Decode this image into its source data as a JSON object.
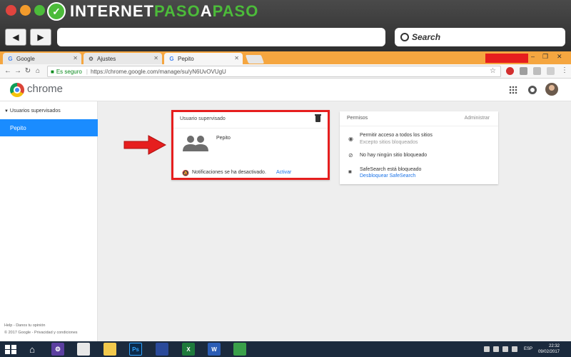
{
  "site_logo": {
    "prefix": "INTERNET",
    "accent": "PASO",
    "joiner": "A",
    "suffix": "PASO"
  },
  "outer_browser": {
    "search_placeholder": "Search"
  },
  "tabs": [
    {
      "label": "Google",
      "icon": "google-icon"
    },
    {
      "label": "Ajustes",
      "icon": "gear-icon"
    },
    {
      "label": "Pepito",
      "icon": "google-icon"
    }
  ],
  "omnibox": {
    "secure_label": "Es seguro",
    "url": "https://chrome.google.com/manage/su/yN6UvOVUgU"
  },
  "header": {
    "brand": "chrome"
  },
  "sidebar": {
    "section": "Usuarios supervisados",
    "items": [
      {
        "label": "Pepito"
      }
    ],
    "footer_line1": "Help - Danos tu opinión",
    "footer_line2": "© 2017 Google - Privacidad y condiciones"
  },
  "user_card": {
    "title": "Usuario supervisado",
    "name": "Pepito",
    "notifications": "Notificaciones se ha desactivado.",
    "activate": "Activar"
  },
  "permissions_card": {
    "title": "Permisos",
    "admin": "Administrar",
    "rows": [
      {
        "main": "Permitir acceso a todos los sitios",
        "sub": "Excepto sitios bloqueados"
      },
      {
        "main": "No hay ningún sitio bloqueado",
        "sub": ""
      },
      {
        "main": "SafeSearch está bloqueado",
        "link": "Desbloquear SafeSearch"
      }
    ]
  },
  "taskbar": {
    "lang": "ESP",
    "time": "22:32",
    "date": "09/02/2017"
  },
  "colors": {
    "highlight_red": "#e61e1e",
    "selected_blue": "#1a8cff",
    "link_blue": "#1a73e8"
  }
}
